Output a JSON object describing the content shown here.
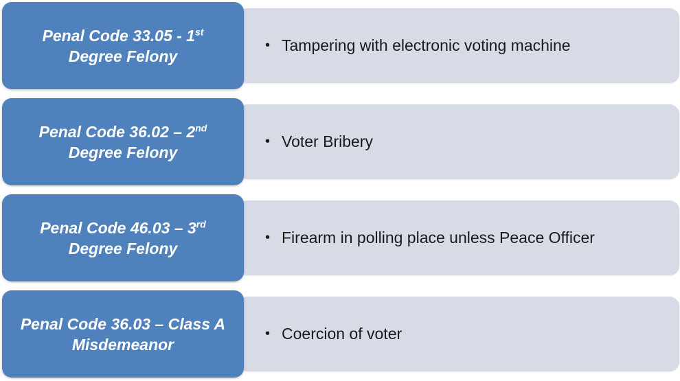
{
  "rows": [
    {
      "code_line1": "Penal Code 33.05 - 1",
      "code_sup": "st",
      "code_line2": "Degree Felony",
      "bullet": "•",
      "offense": "Tampering with electronic voting machine"
    },
    {
      "code_line1": "Penal Code 36.02 – 2",
      "code_sup": "nd",
      "code_line2": "Degree Felony",
      "bullet": "•",
      "offense": "Voter Bribery"
    },
    {
      "code_line1": "Penal Code 46.03 – 3",
      "code_sup": "rd",
      "code_line2": "Degree Felony",
      "bullet": "•",
      "offense": "Firearm in polling place unless Peace Officer"
    },
    {
      "code_line1": "Penal Code 36.03 – Class A",
      "code_sup": "",
      "code_line2": "Misdemeanor",
      "bullet": "•",
      "offense": "Coercion of voter"
    }
  ],
  "colors": {
    "code_box": "#4f81bd",
    "detail_box": "#d6dbe6",
    "code_text": "#ffffff",
    "detail_text": "#1a1a1a"
  }
}
